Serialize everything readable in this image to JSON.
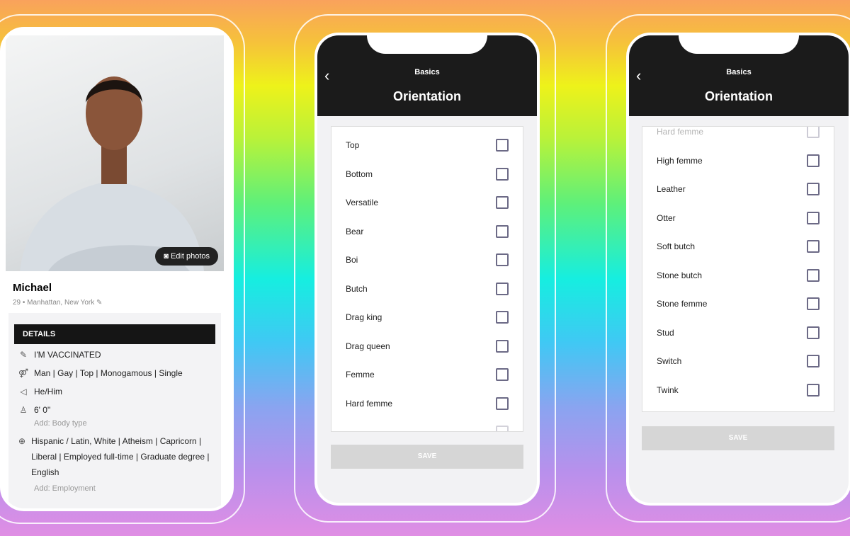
{
  "profile": {
    "name": "Michael",
    "meta": "29 • Manhattan, New York",
    "edit_photos": "Edit photos",
    "details_header": "DETAILS",
    "vaccinated": "I'M VACCINATED",
    "identity": "Man | Gay | Top | Monogamous | Single",
    "pronouns": "He/Him",
    "height": "6' 0\"",
    "add_body": "Add: Body type",
    "background": "Hispanic / Latin, White | Atheism | Capricorn | Liberal | Employed full-time | Graduate degree | English",
    "add_employment": "Add: Employment"
  },
  "screen2": {
    "back": "‹",
    "subtitle": "Basics",
    "title": "Orientation",
    "save": "SAVE",
    "items": [
      "Top",
      "Bottom",
      "Versatile",
      "Bear",
      "Boi",
      "Butch",
      "Drag king",
      "Drag queen",
      "Femme",
      "Hard femme"
    ]
  },
  "screen3": {
    "back": "‹",
    "subtitle": "Basics",
    "title": "Orientation",
    "save": "SAVE",
    "items": [
      "Hard femme",
      "High femme",
      "Leather",
      "Otter",
      "Soft butch",
      "Stone butch",
      "Stone femme",
      "Stud",
      "Switch",
      "Twink"
    ]
  }
}
